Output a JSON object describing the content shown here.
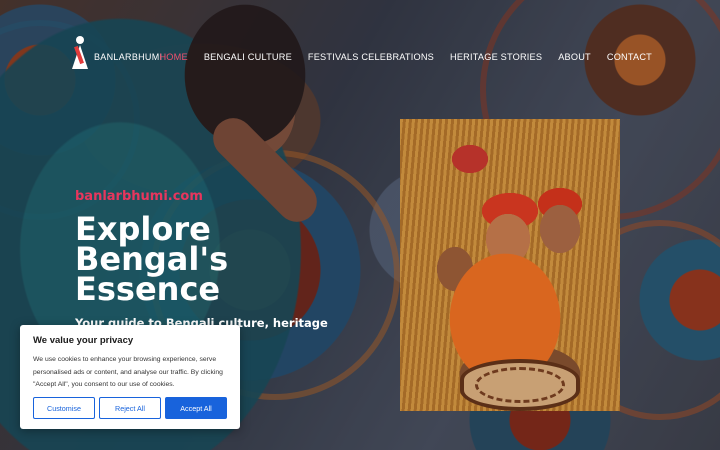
{
  "brand": {
    "name": "BANLARBHUMI"
  },
  "nav": {
    "items": [
      {
        "label": "HOME",
        "active": true
      },
      {
        "label": "BENGALI CULTURE",
        "active": false
      },
      {
        "label": "FESTIVALS CELEBRATIONS",
        "active": false
      },
      {
        "label": "HERITAGE STORIES",
        "active": false
      },
      {
        "label": "ABOUT",
        "active": false
      },
      {
        "label": "CONTACT",
        "active": false
      }
    ]
  },
  "hero": {
    "eyebrow": "banlarbhumi.com",
    "headline": "Explore Bengal's Essence",
    "subtext": "Your guide to Bengali culture, heritage tales, and festivals."
  },
  "cookie": {
    "title": "We value your privacy",
    "body": "We use cookies to enhance your browsing experience, serve personalised ads or content, and analyse our traffic. By clicking \"Accept All\", you consent to our use of cookies.",
    "customise_label": "Customise",
    "reject_label": "Reject All",
    "accept_label": "Accept All"
  },
  "colors": {
    "accent": "#e8365d",
    "nav_active": "#f0506e",
    "button_primary": "#1863dc"
  }
}
